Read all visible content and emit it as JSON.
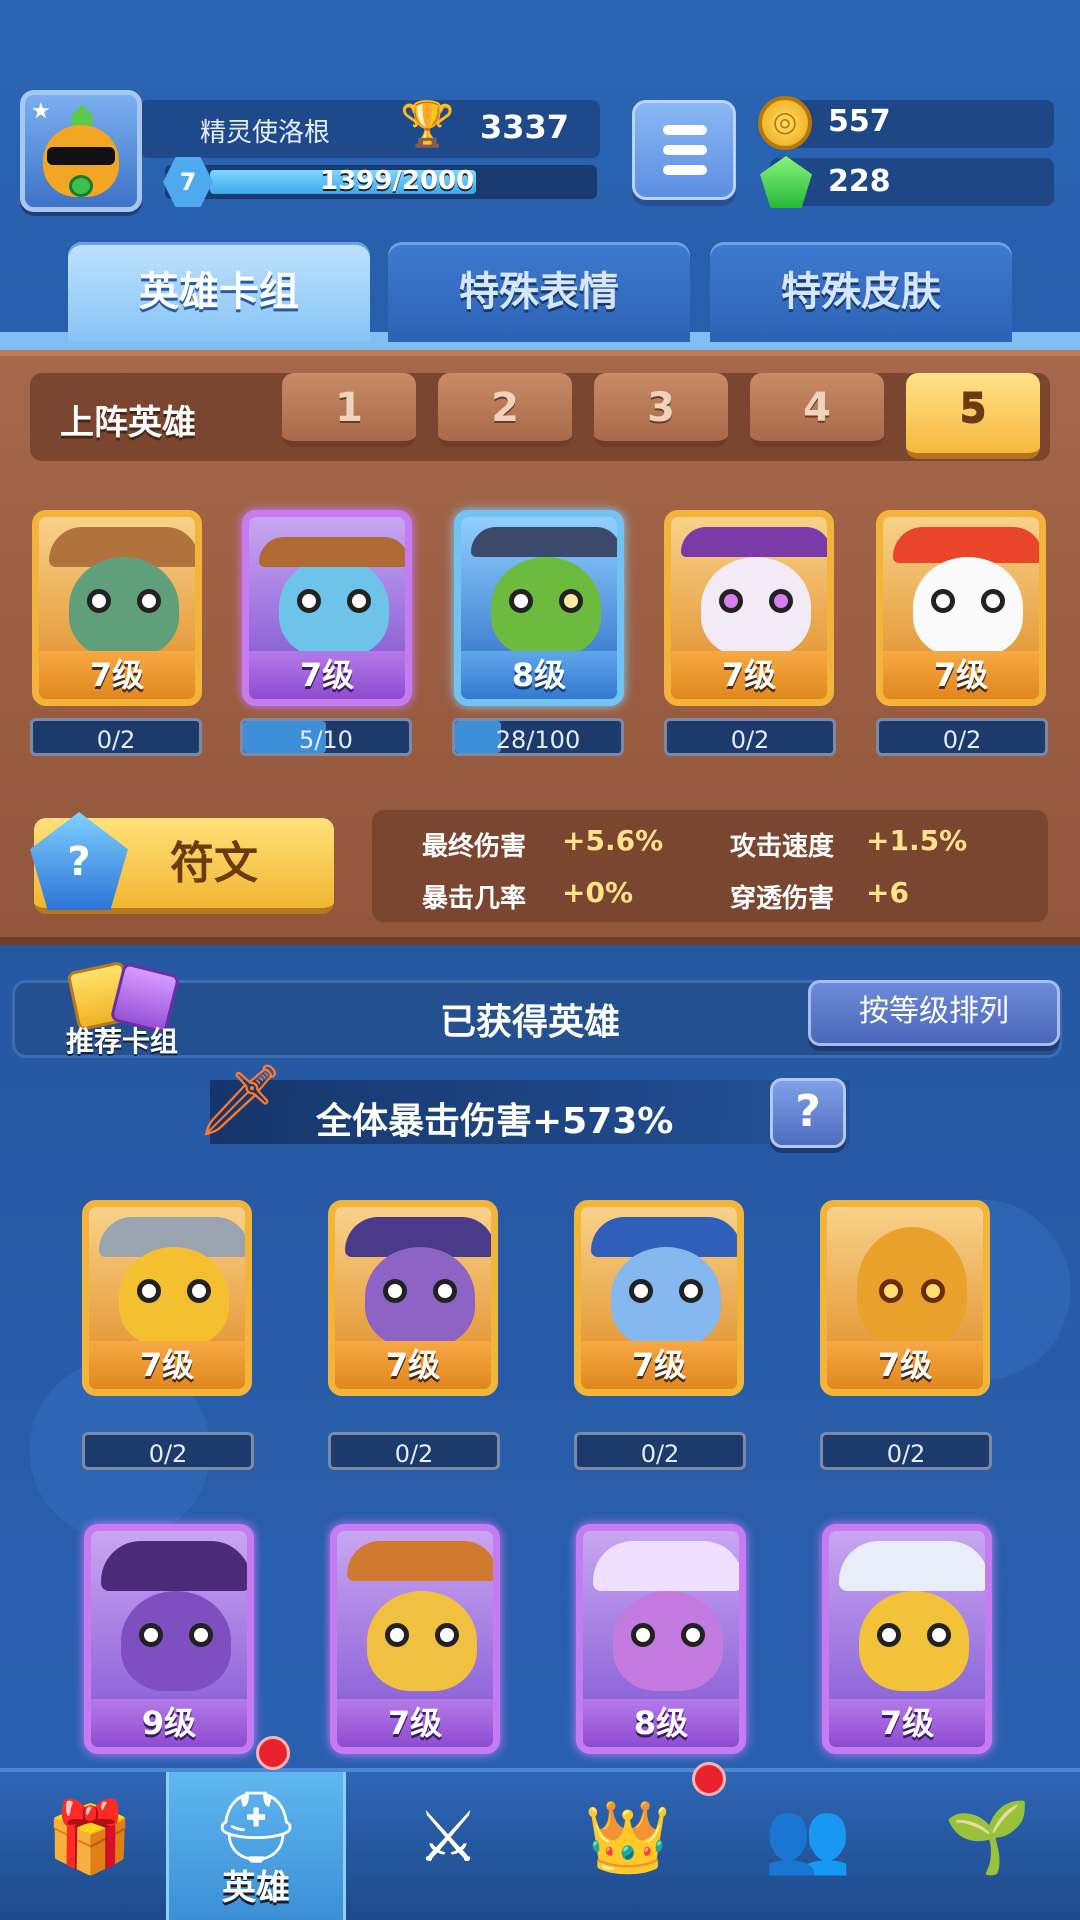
{
  "player": {
    "name": "精灵使洛根",
    "trophies": "3337",
    "level": "7",
    "xp_text": "1399/2000",
    "xp_fraction": 0.6995
  },
  "currency": {
    "coins": "557",
    "gems": "228"
  },
  "tabs": [
    {
      "label": "英雄卡组"
    },
    {
      "label": "特殊表情"
    },
    {
      "label": "特殊皮肤"
    }
  ],
  "deck": {
    "title": "上阵英雄",
    "slots": [
      "1",
      "2",
      "3",
      "4",
      "5"
    ],
    "selected_slot": "5",
    "heroes": [
      {
        "level": "7级",
        "progress": "0/2",
        "rarity": "gold"
      },
      {
        "level": "7级",
        "progress": "5/10",
        "rarity": "purple",
        "fill": 0.5
      },
      {
        "level": "8级",
        "progress": "28/100",
        "rarity": "blue",
        "fill": 0.28
      },
      {
        "level": "7级",
        "progress": "0/2",
        "rarity": "gold"
      },
      {
        "level": "7级",
        "progress": "0/2",
        "rarity": "gold"
      }
    ]
  },
  "rune": {
    "label": "符文",
    "icon": "?",
    "stats": [
      {
        "name": "最终伤害",
        "value": "+5.6%"
      },
      {
        "name": "攻击速度",
        "value": "+1.5%"
      },
      {
        "name": "暴击几率",
        "value": "+0%"
      },
      {
        "name": "穿透伤害",
        "value": "+6"
      }
    ]
  },
  "owned": {
    "title": "已获得英雄",
    "recommend_label": "推荐卡组",
    "sort_label": "按等级排列",
    "crit_text": "全体暴击伤害+573%",
    "help_label": "?",
    "heroes_row1": [
      {
        "level": "7级",
        "progress": "0/2"
      },
      {
        "level": "7级",
        "progress": "0/2"
      },
      {
        "level": "7级",
        "progress": "0/2"
      },
      {
        "level": "7级",
        "progress": "0/2"
      }
    ],
    "heroes_row2": [
      {
        "level": "9级"
      },
      {
        "level": "7级"
      },
      {
        "level": "8级"
      },
      {
        "level": "7级"
      }
    ]
  },
  "nav": {
    "items": [
      {
        "icon": "treasure-chest-icon"
      },
      {
        "icon": "knight-helmet-icon",
        "label": "英雄"
      },
      {
        "icon": "crossed-swords-icon"
      },
      {
        "icon": "crown-shield-icon"
      },
      {
        "icon": "guild-banner-icon"
      },
      {
        "icon": "sprout-island-icon"
      }
    ]
  },
  "colors": {
    "accent": "#2b5fa8",
    "wood": "#a6674a",
    "gold": "#f2b43a",
    "purple": "#c67bf0",
    "blue": "#73c3f2",
    "badge": "#e8232e"
  }
}
